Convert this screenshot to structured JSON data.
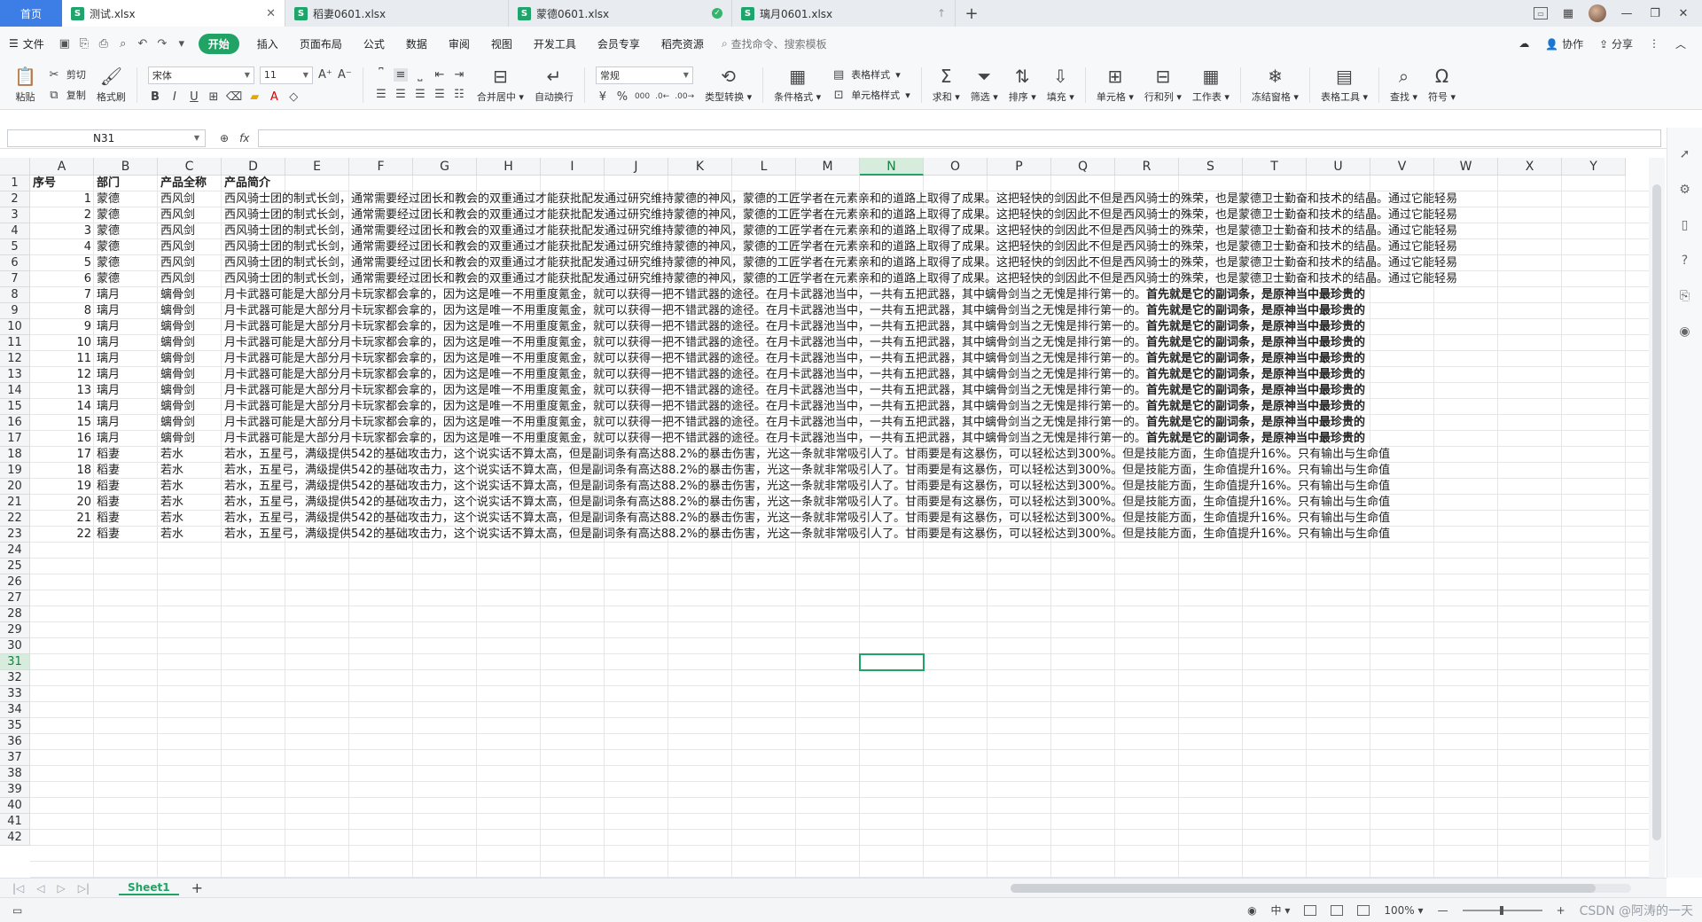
{
  "tabs": {
    "home": "首页",
    "docs": [
      {
        "label": "测试.xlsx",
        "active": true,
        "status": "close"
      },
      {
        "label": "稻妻0601.xlsx",
        "active": false,
        "status": ""
      },
      {
        "label": "蒙德0601.xlsx",
        "active": false,
        "status": "ok"
      },
      {
        "label": "璃月0601.xlsx",
        "active": false,
        "status": "upload"
      }
    ]
  },
  "menu": {
    "file": "文件",
    "items": [
      "开始",
      "插入",
      "页面布局",
      "公式",
      "数据",
      "审阅",
      "视图",
      "开发工具",
      "会员专享",
      "稻壳资源"
    ],
    "active_index": 0,
    "search_placeholder": "查找命令、搜索模板",
    "collab": "协作",
    "share": "分享"
  },
  "ribbon": {
    "paste": "粘贴",
    "cut": "剪切",
    "copy": "复制",
    "format_painter": "格式刷",
    "font_name": "宋体",
    "font_size": "11",
    "merge_center": "合并居中",
    "wrap_text": "自动换行",
    "number_format": "常规",
    "type_convert": "类型转换",
    "conditional_format": "条件格式",
    "table_style": "表格样式",
    "cell_style": "单元格样式",
    "sum": "求和",
    "filter": "筛选",
    "sort": "排序",
    "fill": "填充",
    "cells": "单元格",
    "row_col": "行和列",
    "worksheet": "工作表",
    "freeze": "冻结窗格",
    "table_tools": "表格工具",
    "find": "查找",
    "symbol": "符号"
  },
  "formula": {
    "name_box": "N31",
    "fx": "fx",
    "value": ""
  },
  "grid": {
    "columns": [
      "A",
      "B",
      "C",
      "D",
      "E",
      "F",
      "G",
      "H",
      "I",
      "J",
      "K",
      "L",
      "M",
      "N",
      "O",
      "P",
      "Q",
      "R",
      "S",
      "T",
      "U",
      "V",
      "W",
      "X",
      "Y"
    ],
    "selected_column": "N",
    "selected_row": 31,
    "row_count": 42,
    "headers": [
      "序号",
      "部门",
      "产品全称",
      "产品简介"
    ],
    "rows": [
      {
        "no": 1,
        "dept": "蒙德",
        "product": "西风剑",
        "desc_key": "mond"
      },
      {
        "no": 2,
        "dept": "蒙德",
        "product": "西风剑",
        "desc_key": "mond"
      },
      {
        "no": 3,
        "dept": "蒙德",
        "product": "西风剑",
        "desc_key": "mond"
      },
      {
        "no": 4,
        "dept": "蒙德",
        "product": "西风剑",
        "desc_key": "mond"
      },
      {
        "no": 5,
        "dept": "蒙德",
        "product": "西风剑",
        "desc_key": "mond"
      },
      {
        "no": 6,
        "dept": "蒙德",
        "product": "西风剑",
        "desc_key": "mond"
      },
      {
        "no": 7,
        "dept": "璃月",
        "product": "螭骨剑",
        "desc_key": "liyue"
      },
      {
        "no": 8,
        "dept": "璃月",
        "product": "螭骨剑",
        "desc_key": "liyue"
      },
      {
        "no": 9,
        "dept": "璃月",
        "product": "螭骨剑",
        "desc_key": "liyue"
      },
      {
        "no": 10,
        "dept": "璃月",
        "product": "螭骨剑",
        "desc_key": "liyue"
      },
      {
        "no": 11,
        "dept": "璃月",
        "product": "螭骨剑",
        "desc_key": "liyue"
      },
      {
        "no": 12,
        "dept": "璃月",
        "product": "螭骨剑",
        "desc_key": "liyue"
      },
      {
        "no": 13,
        "dept": "璃月",
        "product": "螭骨剑",
        "desc_key": "liyue"
      },
      {
        "no": 14,
        "dept": "璃月",
        "product": "螭骨剑",
        "desc_key": "liyue"
      },
      {
        "no": 15,
        "dept": "璃月",
        "product": "螭骨剑",
        "desc_key": "liyue"
      },
      {
        "no": 16,
        "dept": "璃月",
        "product": "螭骨剑",
        "desc_key": "liyue"
      },
      {
        "no": 17,
        "dept": "稻妻",
        "product": "若水",
        "desc_key": "inazuma"
      },
      {
        "no": 18,
        "dept": "稻妻",
        "product": "若水",
        "desc_key": "inazuma"
      },
      {
        "no": 19,
        "dept": "稻妻",
        "product": "若水",
        "desc_key": "inazuma"
      },
      {
        "no": 20,
        "dept": "稻妻",
        "product": "若水",
        "desc_key": "inazuma"
      },
      {
        "no": 21,
        "dept": "稻妻",
        "product": "若水",
        "desc_key": "inazuma"
      },
      {
        "no": 22,
        "dept": "稻妻",
        "product": "若水",
        "desc_key": "inazuma"
      }
    ],
    "descriptions": {
      "mond": {
        "normal": "西风骑士团的制式长剑，通常需要经过团长和教会的双重通过才能获批配发通过研究维持蒙德的神风，蒙德的工匠学者在元素亲和的道路上取得了成果。这把轻快的剑因此不但是西风骑士的殊荣，也是蒙德卫士勤奋和技术的结晶。通过它能轻易",
        "bold": ""
      },
      "liyue": {
        "normal": "月卡武器可能是大部分月卡玩家都会拿的，因为这是唯一不用重度氪金，就可以获得一把不错武器的途径。在月卡武器池当中，一共有五把武器，其中螭骨剑当之无愧是排行第一的。",
        "bold": "首先就是它的副词条，是原神当中最珍贵的"
      },
      "inazuma": {
        "normal": "若水，五星弓，满级提供542的基础攻击力，这个说实话不算太高，但是副词条有高达88.2%的暴击伤害，光这一条就非常吸引人了。甘雨要是有这暴伤，可以轻松达到300%。但是技能方面，生命值提升16%。只有输出与生命值",
        "bold": ""
      }
    }
  },
  "sheets": {
    "tabs": [
      "Sheet1"
    ],
    "active": "Sheet1"
  },
  "status": {
    "input_mode": "中",
    "zoom": "100%",
    "watermark": "CSDN @阿涛的一天"
  }
}
